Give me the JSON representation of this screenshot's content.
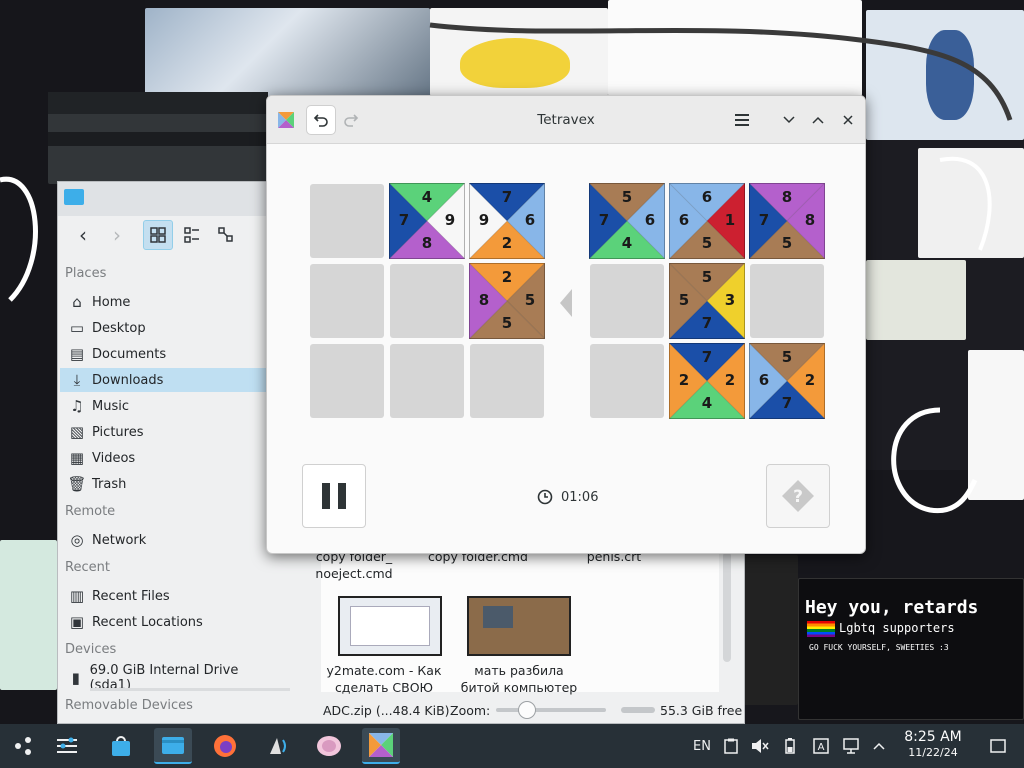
{
  "tetravex": {
    "title": "Tetravex",
    "timer": "01:06",
    "icons": {
      "app": "tetravex-app-icon",
      "undo": "undo-icon",
      "redo": "redo-icon",
      "menu": "hamburger-menu-icon",
      "minimize": "chevron-down-icon",
      "maximize": "chevron-up-icon",
      "close": "close-icon",
      "pause": "pause-icon",
      "hint": "question-mark-icon",
      "clock": "clock-icon"
    },
    "colors": {
      "1": "#cc2030",
      "2": "#f39a3a",
      "3": "#efd02c",
      "4": "#5bd27a",
      "5": "#a87c55",
      "6": "#88b6e8",
      "7": "#1b4fa8",
      "8": "#b460cc",
      "9": "#f7f7f7"
    },
    "board": [
      [
        null,
        {
          "t": 4,
          "r": 9,
          "b": 8,
          "l": 7
        },
        {
          "t": 7,
          "r": 6,
          "b": 2,
          "l": 9
        }
      ],
      [
        null,
        null,
        {
          "t": 2,
          "r": 5,
          "b": 5,
          "l": 8
        }
      ],
      [
        null,
        null,
        null
      ]
    ],
    "pool": [
      [
        {
          "t": 5,
          "r": 6,
          "b": 4,
          "l": 7
        },
        {
          "t": 6,
          "r": 1,
          "b": 5,
          "l": 6
        },
        {
          "t": 8,
          "r": 8,
          "b": 5,
          "l": 7
        }
      ],
      [
        null,
        {
          "t": 5,
          "r": 3,
          "b": 7,
          "l": 5
        },
        null
      ],
      [
        null,
        {
          "t": 7,
          "r": 2,
          "b": 4,
          "l": 2
        },
        {
          "t": 5,
          "r": 2,
          "b": 7,
          "l": 6
        }
      ]
    ]
  },
  "dolphin": {
    "places_header": "Places",
    "places": [
      {
        "label": "Home",
        "icon": "home-icon"
      },
      {
        "label": "Desktop",
        "icon": "desktop-icon"
      },
      {
        "label": "Documents",
        "icon": "documents-icon"
      },
      {
        "label": "Downloads",
        "icon": "downloads-icon"
      },
      {
        "label": "Music",
        "icon": "music-icon"
      },
      {
        "label": "Pictures",
        "icon": "pictures-icon"
      },
      {
        "label": "Videos",
        "icon": "videos-icon"
      },
      {
        "label": "Trash",
        "icon": "trash-icon"
      }
    ],
    "remote_header": "Remote",
    "remote": [
      {
        "label": "Network",
        "icon": "network-icon"
      }
    ],
    "recent_header": "Recent",
    "recent": [
      {
        "label": "Recent Files",
        "icon": "recent-files-icon"
      },
      {
        "label": "Recent Locations",
        "icon": "recent-locations-icon"
      }
    ],
    "devices_header": "Devices",
    "devices": [
      {
        "label": "69.0 GiB Internal Drive (sda1)",
        "icon": "drive-icon"
      }
    ],
    "removable_header": "Removable Devices",
    "files": [
      {
        "name_line1": "copy folder_",
        "name_line2": "noeject.cmd"
      },
      {
        "name_line1": "copy folder.cmd",
        "name_line2": ""
      },
      {
        "name_line1": "penis.crt",
        "name_line2": ""
      },
      {
        "name_line1": "y2mate.com - Как",
        "name_line2": "сделать СВОЮ"
      },
      {
        "name_line1": "мать разбила",
        "name_line2": "битой компьютер"
      }
    ],
    "status_selection": "ADC.zip (...48.4 KiB)",
    "zoom_label": "Zoom:",
    "free_space": "55.3 GiB free"
  },
  "background": {
    "sign_title": "Hey you, retards",
    "sign_subtitle": "Lgbtq supporters",
    "sign_line": "GO FUCK YOURSELF, SWEETIES :3"
  },
  "taskbar": {
    "items": [
      {
        "name": "application-launcher-icon"
      },
      {
        "name": "system-settings-icon"
      },
      {
        "name": "discover-store-icon"
      },
      {
        "name": "dolphin-file-manager-icon"
      },
      {
        "name": "firefox-icon"
      },
      {
        "name": "audio-app-icon"
      },
      {
        "name": "ball-app-icon"
      },
      {
        "name": "tetravex-taskbar-icon"
      }
    ],
    "language": "EN",
    "time": "8:25 AM",
    "date": "11/22/24"
  }
}
